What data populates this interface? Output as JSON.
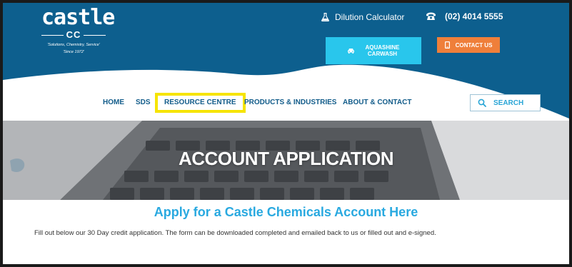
{
  "colors": {
    "header_bg": "#0d5f8e",
    "aqua_button": "#29c6ec",
    "contact_button": "#ef7f3a",
    "nav_text": "#125c8a",
    "highlight": "#f6e400",
    "heading_blue": "#29a9e0"
  },
  "logo": {
    "word": "castle",
    "monogram": "CC",
    "slogan": "'Solutions, Chemistry, Service'",
    "since": "'Since 1972'"
  },
  "header": {
    "dilution_label": "Dilution Calculator",
    "dilution_icon": "flask-icon",
    "phone_number": "(02) 4014 5555",
    "phone_icon": "phone-icon",
    "aquashine_line1": "AQUASHINE",
    "aquashine_line2": "CARWASH",
    "aquashine_icon": "car-icon",
    "contact_label": "CONTACT US",
    "contact_icon": "mobile-icon"
  },
  "nav": {
    "items": [
      {
        "label": "HOME"
      },
      {
        "label": "SDS"
      },
      {
        "label": "RESOURCE CENTRE"
      },
      {
        "label": "PRODUCTS & INDUSTRIES"
      },
      {
        "label": "ABOUT & CONTACT"
      }
    ],
    "search_placeholder": "SEARCH",
    "search_icon": "search-icon"
  },
  "hero": {
    "title": "ACCOUNT APPLICATION"
  },
  "content": {
    "heading": "Apply for a Castle Chemicals Account Here",
    "body": "Fill out below our 30 Day credit application. The form can be downloaded completed and emailed back to us or filled out and e-signed."
  }
}
